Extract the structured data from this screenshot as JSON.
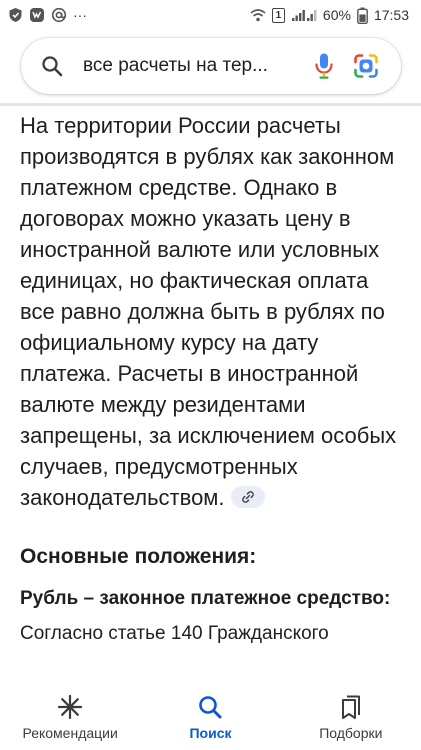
{
  "status_bar": {
    "more": "···",
    "sim_badge": "1",
    "battery_percent": "60%",
    "time": "17:53"
  },
  "search": {
    "query": "все расчеты на тер..."
  },
  "answer": {
    "paragraph": "На территории России расчеты производятся в рублях как законном платежном средстве. Однако в договорах можно указать цену в иностранной валюте или условных единицах, но фактическая оплата все равно должна быть в рублях по официальному курсу на дату платежа. Расчеты в иностранной валюте между резидентами запрещены, за исключением особых случаев, предусмотренных законодательством.",
    "section_title": "Основные положения:",
    "sub_heading": "Рубль – законное платежное средство:",
    "cut_line": "Согласно статье 140 Гражданского"
  },
  "bottom_nav": {
    "items": [
      {
        "label": "Рекомендации",
        "icon": "asterisk-icon"
      },
      {
        "label": "Поиск",
        "icon": "search-icon",
        "active": true
      },
      {
        "label": "Подборки",
        "icon": "collections-icon"
      }
    ]
  },
  "colors": {
    "accent": "#0b57d0",
    "text": "#1f1f1f"
  }
}
